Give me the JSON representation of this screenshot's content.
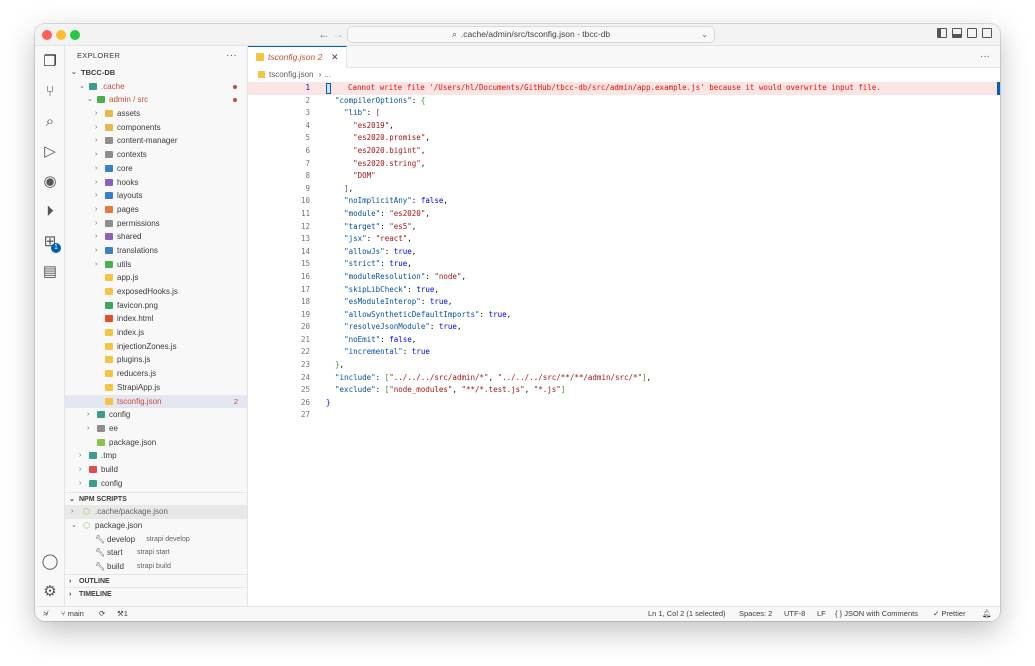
{
  "title": {
    "search_text": ".cache/admin/src/tsconfig.json - tbcc-db"
  },
  "sidebar": {
    "header": "EXPLORER",
    "tree": [
      {
        "label": "TBCC-DB",
        "indent": 0,
        "chev": "⌄",
        "kind": "root"
      },
      {
        "label": ".cache",
        "indent": 1,
        "chev": "⌄",
        "kind": "folder",
        "color": "#3b9d8c",
        "status": "dot",
        "text_class": "c-red"
      },
      {
        "label": "admin / src",
        "indent": 2,
        "chev": "⌄",
        "kind": "folder",
        "color": "#4caf50",
        "status": "dot",
        "text_class": "c-red"
      },
      {
        "label": "assets",
        "indent": 3,
        "chev": "›",
        "kind": "folder",
        "color": "#e8b84a"
      },
      {
        "label": "components",
        "indent": 3,
        "chev": "›",
        "kind": "folder",
        "color": "#e8b84a"
      },
      {
        "label": "content-manager",
        "indent": 3,
        "chev": "›",
        "kind": "folder",
        "color": "#8e8e8e"
      },
      {
        "label": "contexts",
        "indent": 3,
        "chev": "›",
        "kind": "folder",
        "color": "#8e8e8e"
      },
      {
        "label": "core",
        "indent": 3,
        "chev": "›",
        "kind": "folder",
        "color": "#3b7fc4"
      },
      {
        "label": "hooks",
        "indent": 3,
        "chev": "›",
        "kind": "folder",
        "color": "#8e5fb8"
      },
      {
        "label": "layouts",
        "indent": 3,
        "chev": "›",
        "kind": "folder",
        "color": "#3b7fc4"
      },
      {
        "label": "pages",
        "indent": 3,
        "chev": "›",
        "kind": "folder",
        "color": "#e07b3c"
      },
      {
        "label": "permissions",
        "indent": 3,
        "chev": "›",
        "kind": "folder",
        "color": "#8e8e8e"
      },
      {
        "label": "shared",
        "indent": 3,
        "chev": "›",
        "kind": "folder",
        "color": "#8e5fb8"
      },
      {
        "label": "translations",
        "indent": 3,
        "chev": "›",
        "kind": "folder",
        "color": "#3b7fc4"
      },
      {
        "label": "utils",
        "indent": 3,
        "chev": "›",
        "kind": "folder",
        "color": "#4caf50"
      },
      {
        "label": "app.js",
        "indent": 3,
        "chev": "",
        "kind": "file",
        "color": "#f4c542"
      },
      {
        "label": "exposedHooks.js",
        "indent": 3,
        "chev": "",
        "kind": "file",
        "color": "#f4c542"
      },
      {
        "label": "favicon.png",
        "indent": 3,
        "chev": "",
        "kind": "file",
        "color": "#3ba55d"
      },
      {
        "label": "index.html",
        "indent": 3,
        "chev": "",
        "kind": "file",
        "color": "#e44d26"
      },
      {
        "label": "index.js",
        "indent": 3,
        "chev": "",
        "kind": "file",
        "color": "#f4c542"
      },
      {
        "label": "injectionZones.js",
        "indent": 3,
        "chev": "",
        "kind": "file",
        "color": "#f4c542"
      },
      {
        "label": "plugins.js",
        "indent": 3,
        "chev": "",
        "kind": "file",
        "color": "#f4c542"
      },
      {
        "label": "reducers.js",
        "indent": 3,
        "chev": "",
        "kind": "file",
        "color": "#f4c542"
      },
      {
        "label": "StrapiApp.js",
        "indent": 3,
        "chev": "",
        "kind": "file",
        "color": "#f4c542"
      },
      {
        "label": "tsconfig.json",
        "indent": 3,
        "chev": "",
        "kind": "file",
        "color": "#f4c542",
        "selected": true,
        "count": "2",
        "text_class": "c-red"
      },
      {
        "label": "config",
        "indent": 2,
        "chev": "›",
        "kind": "folder",
        "color": "#3b9d8c"
      },
      {
        "label": "ee",
        "indent": 2,
        "chev": "›",
        "kind": "folder",
        "color": "#8e8e8e"
      },
      {
        "label": "package.json",
        "indent": 2,
        "chev": "",
        "kind": "file",
        "color": "#8bc34a"
      },
      {
        "label": ".tmp",
        "indent": 1,
        "chev": "›",
        "kind": "folder",
        "color": "#3b9d8c"
      },
      {
        "label": "build",
        "indent": 1,
        "chev": "›",
        "kind": "folder",
        "color": "#e44d4d"
      },
      {
        "label": "config",
        "indent": 1,
        "chev": "›",
        "kind": "folder",
        "color": "#3b9d8c"
      }
    ],
    "npm_header": "NPM SCRIPTS",
    "npm": [
      {
        "label": ".cache/package.json",
        "indent": 0,
        "chev": "›",
        "kind": "pkg",
        "hl": true
      },
      {
        "label": "package.json",
        "indent": 0,
        "chev": "⌄",
        "kind": "pkg"
      },
      {
        "label": "develop",
        "sub": "strapi develop",
        "indent": 1,
        "kind": "script"
      },
      {
        "label": "start",
        "sub": "strapi start",
        "indent": 1,
        "kind": "script"
      },
      {
        "label": "build",
        "sub": "strapi build",
        "indent": 1,
        "kind": "script"
      }
    ],
    "outline_header": "OUTLINE",
    "timeline_header": "TIMELINE"
  },
  "editor": {
    "tab_label": "tsconfig.json 2",
    "breadcrumb_file": "tsconfig.json",
    "breadcrumb_more": "…",
    "error_message": "Cannot write file '/Users/hl/Documents/GitHub/tbcc-db/src/admin/app.example.js' because it would overwrite input file.",
    "lines": [
      {
        "n": "1",
        "html": "<span class=\"b\">{</span>"
      },
      {
        "n": "2",
        "html": "  <span class=\"k\">\"compilerOptions\"</span>: <span class=\"p\">{</span>"
      },
      {
        "n": "3",
        "html": "    <span class=\"k\">\"lib\"</span>: <span class=\"o\">[</span>"
      },
      {
        "n": "4",
        "html": "      <span class=\"s\">\"es2019\"</span>,"
      },
      {
        "n": "5",
        "html": "      <span class=\"s\">\"es2020.promise\"</span>,"
      },
      {
        "n": "6",
        "html": "      <span class=\"s\">\"es2020.bigint\"</span>,"
      },
      {
        "n": "7",
        "html": "      <span class=\"s\">\"es2020.string\"</span>,"
      },
      {
        "n": "8",
        "html": "      <span class=\"s\">\"DOM\"</span>"
      },
      {
        "n": "9",
        "html": "    <span class=\"o\">]</span>,"
      },
      {
        "n": "10",
        "html": "    <span class=\"k\">\"noImplicitAny\"</span>: <span class=\"b\">false</span>,"
      },
      {
        "n": "11",
        "html": "    <span class=\"k\">\"module\"</span>: <span class=\"s\">\"es2020\"</span>,"
      },
      {
        "n": "12",
        "html": "    <span class=\"k\">\"target\"</span>: <span class=\"s\">\"es5\"</span>,"
      },
      {
        "n": "13",
        "html": "    <span class=\"k\">\"jsx\"</span>: <span class=\"s\">\"react\"</span>,"
      },
      {
        "n": "14",
        "html": "    <span class=\"k\">\"allowJs\"</span>: <span class=\"b\">true</span>,"
      },
      {
        "n": "15",
        "html": "    <span class=\"k\">\"strict\"</span>: <span class=\"b\">true</span>,"
      },
      {
        "n": "16",
        "html": "    <span class=\"k\">\"moduleResolution\"</span>: <span class=\"s\">\"node\"</span>,"
      },
      {
        "n": "17",
        "html": "    <span class=\"k\">\"skipLibCheck\"</span>: <span class=\"b\">true</span>,"
      },
      {
        "n": "18",
        "html": "    <span class=\"k\">\"esModuleInterop\"</span>: <span class=\"b\">true</span>,"
      },
      {
        "n": "19",
        "html": "    <span class=\"k\">\"allowSyntheticDefaultImports\"</span>: <span class=\"b\">true</span>,"
      },
      {
        "n": "20",
        "html": "    <span class=\"k\">\"resolveJsonModule\"</span>: <span class=\"b\">true</span>,"
      },
      {
        "n": "21",
        "html": "    <span class=\"k\">\"noEmit\"</span>: <span class=\"b\">false</span>,"
      },
      {
        "n": "22",
        "html": "    <span class=\"k\">\"incremental\"</span>: <span class=\"b\">true</span>"
      },
      {
        "n": "23",
        "html": "  <span class=\"p\">}</span>,"
      },
      {
        "n": "24",
        "html": "  <span class=\"k\">\"include\"</span>: <span class=\"p\">[</span><span class=\"s\">\"../../../src/admin/*\"</span>, <span class=\"s\">\"../../../src/**/**/admin/src/*\"</span><span class=\"p\">]</span>,"
      },
      {
        "n": "25",
        "html": "  <span class=\"k\">\"exclude\"</span>: <span class=\"p\">[</span><span class=\"s\">\"node_modules\"</span>, <span class=\"s\">\"**/*.test.js\"</span>, <span class=\"s\">\"*.js\"</span><span class=\"p\">]</span>"
      },
      {
        "n": "26",
        "html": "<span class=\"b\">}</span>"
      },
      {
        "n": "27",
        "html": ""
      }
    ]
  },
  "status": {
    "branch": "main",
    "problems": "1",
    "position": "Ln 1, Col 2 (1 selected)",
    "spaces": "Spaces: 2",
    "encoding": "UTF-8",
    "eol": "LF",
    "language": "JSON with Comments",
    "language_icon": "{ }",
    "formatter": "Prettier"
  },
  "colors": {
    "accent": "#005fb8",
    "error": "#e51400",
    "modified": "#c74e39"
  }
}
